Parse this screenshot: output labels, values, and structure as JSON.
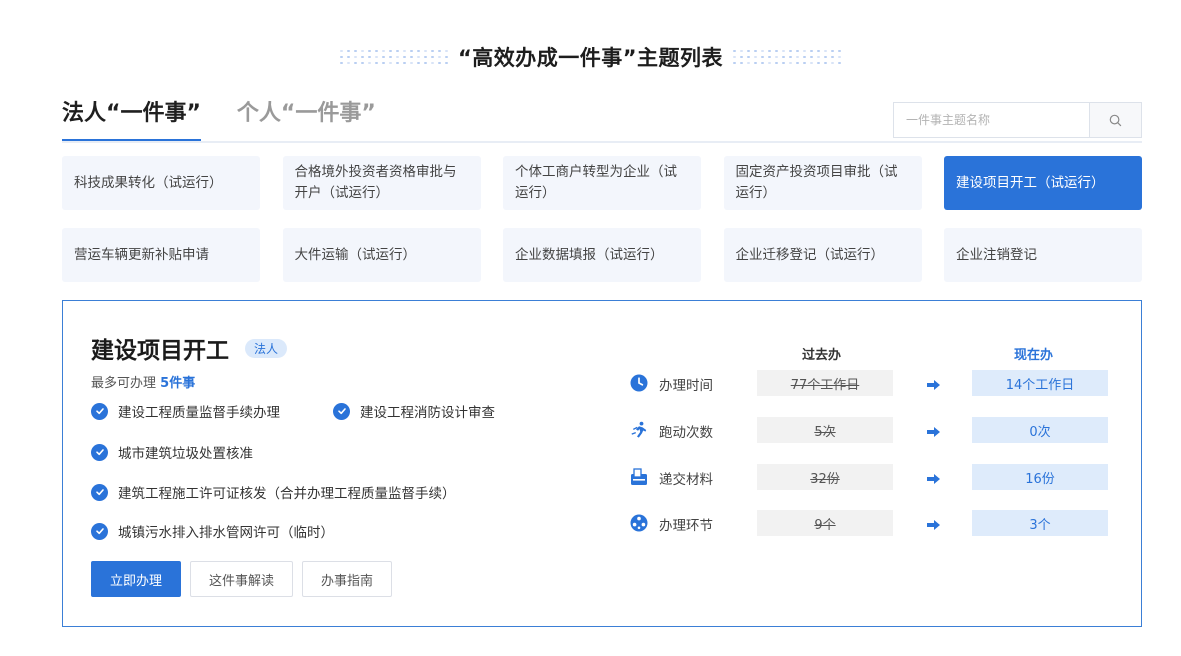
{
  "page_title": "“高效办成一件事”主题列表",
  "tabs": [
    {
      "label": "法人“一件事”"
    },
    {
      "label": "个人“一件事”"
    }
  ],
  "search": {
    "placeholder": "一件事主题名称",
    "icon": "search-icon"
  },
  "topics": [
    {
      "label": "科技成果转化（试运行）"
    },
    {
      "label": "合格境外投资者资格审批与开户（试运行）"
    },
    {
      "label": "个体工商户转型为企业（试运行）"
    },
    {
      "label": "固定资产投资项目审批（试运行）"
    },
    {
      "label": "建设项目开工（试运行）"
    },
    {
      "label": "营运车辆更新补贴申请"
    },
    {
      "label": "大件运输（试运行）"
    },
    {
      "label": "企业数据填报（试运行）"
    },
    {
      "label": "企业迁移登记（试运行）"
    },
    {
      "label": "企业注销登记"
    }
  ],
  "active_topic_index": 4,
  "detail": {
    "title": "建设项目开工",
    "badge": "法人",
    "most_prefix": "最多可办理",
    "most_count": "5件事",
    "items": [
      "建设工程质量监督手续办理",
      "建设工程消防设计审查",
      "城市建筑垃圾处置核准",
      "建筑工程施工许可证核发（合并办理工程质量监督手续）",
      "城镇污水排入排水管网许可（临时）"
    ],
    "buttons": {
      "apply": "立即办理",
      "explain": "这件事解读",
      "guide": "办事指南"
    },
    "compare": {
      "past_header": "过去办",
      "now_header": "现在办",
      "rows": [
        {
          "icon": "clock-icon",
          "label": "办理时间",
          "past": "77个工作日",
          "now": "14个工作日"
        },
        {
          "icon": "runner-icon",
          "label": "跑动次数",
          "past": "5次",
          "now": "0次"
        },
        {
          "icon": "documents-icon",
          "label": "递交材料",
          "past": "32份",
          "now": "16份"
        },
        {
          "icon": "process-icon",
          "label": "办理环节",
          "past": "9个",
          "now": "3个"
        }
      ]
    }
  },
  "colors": {
    "accent": "#2a73d9",
    "topic_bg": "#f3f6fc",
    "now_bg": "#deebfb",
    "past_bg": "#f2f2f2"
  }
}
